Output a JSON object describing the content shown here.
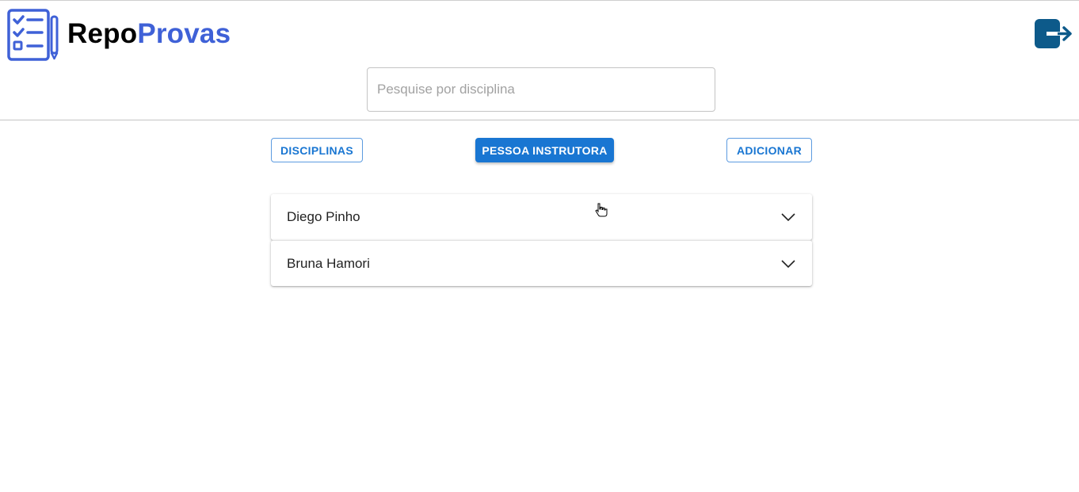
{
  "header": {
    "logo_part1": "Repo",
    "logo_part2": "Provas",
    "search_placeholder": "Pesquise por disciplina",
    "logout_icon": "logout-icon"
  },
  "nav": {
    "disciplinas": "DISCIPLINAS",
    "instrutora": "PESSOA INSTRUTORA",
    "adicionar": "ADICIONAR",
    "active": "instrutora"
  },
  "instructors": [
    {
      "name": "Diego Pinho"
    },
    {
      "name": "Bruna Hamori"
    }
  ],
  "colors": {
    "brand_blue": "#3f61d7",
    "primary": "#1976d2",
    "logout_dark": "#0d5a8a"
  }
}
